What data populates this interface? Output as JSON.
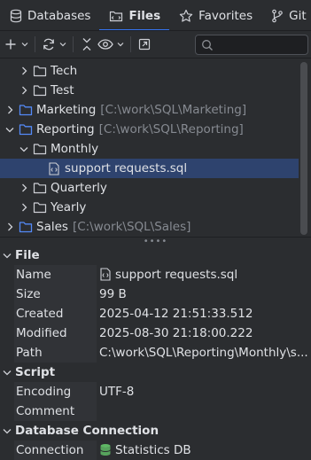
{
  "tabs": [
    {
      "label": "Databases",
      "icon": "database-icon"
    },
    {
      "label": "Files",
      "icon": "files-icon",
      "active": true
    },
    {
      "label": "Favorites",
      "icon": "star-icon"
    },
    {
      "label": "Git",
      "icon": "git-branch-icon"
    }
  ],
  "toolbar": {
    "search_placeholder": "",
    "buttons": [
      "add-icon",
      "chevron-down-icon",
      "refresh-icon",
      "chevron-down-icon",
      "collapse-icon",
      "eye-icon",
      "chevron-down-icon",
      "open-external-icon",
      "search-icon"
    ]
  },
  "tree": [
    {
      "label": "Tech",
      "path": "",
      "indent": 1,
      "expanded": false,
      "type": "folder"
    },
    {
      "label": "Test",
      "path": "",
      "indent": 1,
      "expanded": false,
      "type": "folder"
    },
    {
      "label": "Marketing",
      "path": "[C:\\work\\SQL\\Marketing]",
      "indent": 0,
      "expanded": false,
      "type": "root"
    },
    {
      "label": "Reporting",
      "path": "[C:\\work\\SQL\\Reporting]",
      "indent": 0,
      "expanded": true,
      "type": "root"
    },
    {
      "label": "Monthly",
      "path": "",
      "indent": 1,
      "expanded": true,
      "type": "folder"
    },
    {
      "label": "support requests.sql",
      "path": "",
      "indent": 2,
      "expanded": null,
      "type": "sql",
      "selected": true
    },
    {
      "label": "Quarterly",
      "path": "",
      "indent": 1,
      "expanded": false,
      "type": "folder"
    },
    {
      "label": "Yearly",
      "path": "",
      "indent": 1,
      "expanded": false,
      "type": "folder"
    },
    {
      "label": "Sales",
      "path": "[C:\\work\\SQL\\Sales]",
      "indent": 0,
      "expanded": false,
      "type": "root"
    }
  ],
  "properties": {
    "file": {
      "title": "File",
      "name_key": "Name",
      "name_val": "support requests.sql",
      "size_key": "Size",
      "size_val": "99 B",
      "created_key": "Created",
      "created_val": "2025-04-12 21:51:33.512",
      "modified_key": "Modified",
      "modified_val": "2025-08-30 21:18:00.222",
      "path_key": "Path",
      "path_val": "C:\\work\\SQL\\Reporting\\Monthly\\s..."
    },
    "script": {
      "title": "Script",
      "encoding_key": "Encoding",
      "encoding_val": "UTF-8",
      "comment_key": "Comment",
      "comment_val": ""
    },
    "db": {
      "title": "Database Connection",
      "connection_key": "Connection",
      "connection_val": "Statistics DB"
    }
  },
  "splitter_glyph": "••••",
  "colors": {
    "accent": "#3574f0",
    "selection": "#2e436e",
    "background": "#2b2d30",
    "folder": "#ced0d6",
    "root_folder": "#548af7",
    "db_icon": "#5fb865"
  }
}
